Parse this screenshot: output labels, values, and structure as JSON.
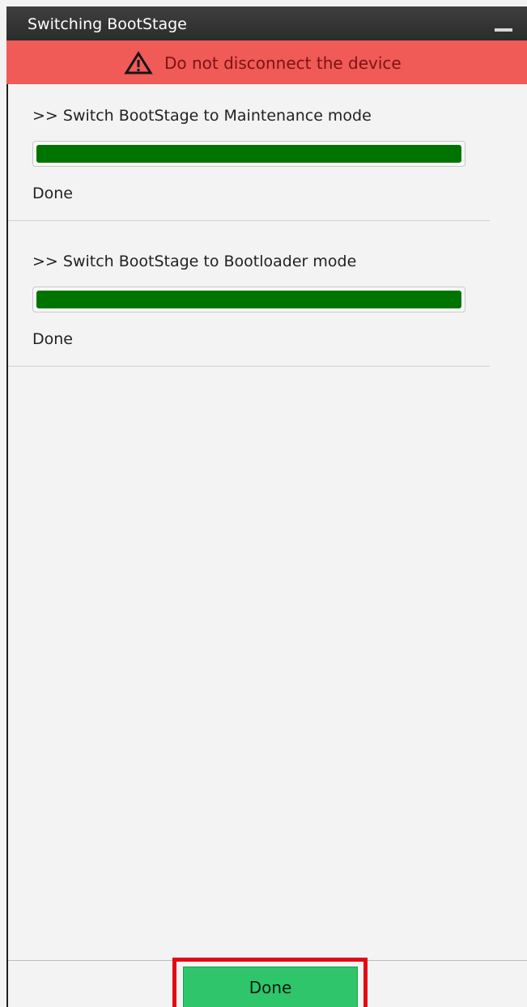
{
  "window": {
    "title": "Switching BootStage"
  },
  "banner": {
    "icon": "warning-triangle-icon",
    "text": "Do not disconnect the device",
    "background_color": "#f05a57"
  },
  "steps": [
    {
      "title": ">> Switch BootStage to Maintenance mode",
      "progress_fraction": 1.0,
      "status": "Done"
    },
    {
      "title": ">> Switch BootStage to Bootloader mode",
      "progress_fraction": 1.0,
      "status": "Done"
    }
  ],
  "progress_color": "#007400",
  "footer": {
    "done_label": "Done",
    "done_color": "#2fc66b",
    "highlight_color": "#e50914"
  }
}
